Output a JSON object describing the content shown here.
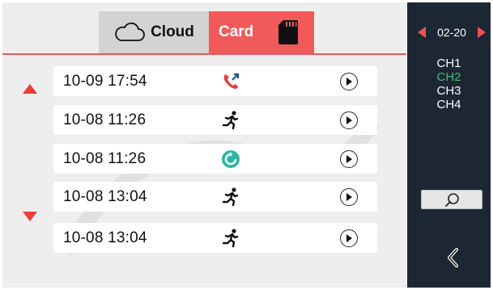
{
  "tabs": {
    "cloud": {
      "label": "Cloud",
      "icon": "cloud-icon"
    },
    "card": {
      "label": "Card",
      "icon": "sd-card-icon",
      "active": true
    }
  },
  "nav": {
    "up_icon": "up-arrow-icon",
    "down_icon": "down-arrow-icon"
  },
  "records": [
    {
      "time": "10-09  17:54",
      "type_icon": "call-icon",
      "action_icon": "play-icon"
    },
    {
      "time": "10-08  11:26",
      "type_icon": "running-man-icon",
      "action_icon": "play-icon"
    },
    {
      "time": "10-08  11:26",
      "type_icon": "refresh-icon",
      "action_icon": "play-icon"
    },
    {
      "time": "10-08  13:04",
      "type_icon": "running-man-icon",
      "action_icon": "play-icon"
    },
    {
      "time": "10-08  13:04",
      "type_icon": "running-man-icon",
      "action_icon": "play-icon"
    }
  ],
  "sidebar": {
    "date": "02-20",
    "channels": [
      "CH1",
      "CH2",
      "CH3",
      "CH4"
    ],
    "active_channel": "CH2",
    "search_icon": "search-icon",
    "back_icon": "back-icon"
  },
  "colors": {
    "accent": "#f05a5a",
    "divider": "#e2595a",
    "active_channel": "#3ec06a",
    "sidebar_bg": "#1c2733",
    "call_icon": "#e0423c",
    "refresh_icon": "#2bb5a5"
  }
}
